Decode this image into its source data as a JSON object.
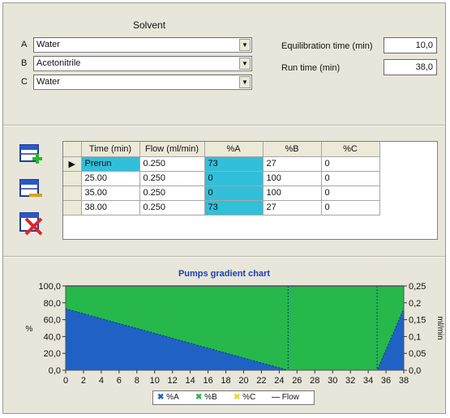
{
  "solvent": {
    "title": "Solvent",
    "rows": [
      {
        "letter": "A",
        "value": "Water"
      },
      {
        "letter": "B",
        "value": "Acetonitrile"
      },
      {
        "letter": "C",
        "value": "Water"
      }
    ]
  },
  "settings": {
    "equilibration_label": "Equilibration time (min)",
    "equilibration_value": "10,0",
    "run_label": "Run time (min)",
    "run_value": "38,0"
  },
  "toolbar": {
    "add_row_icon": "add-row-icon",
    "remove_row_icon": "remove-row-icon",
    "delete_icon": "delete-icon"
  },
  "table": {
    "columns": [
      "Time (min)",
      "Flow (ml/min)",
      "%A",
      "%B",
      "%C"
    ],
    "rows": [
      [
        "Prerun",
        "0.250",
        "73",
        "27",
        "0"
      ],
      [
        "25.00",
        "0.250",
        "0",
        "100",
        "0"
      ],
      [
        "35.00",
        "0.250",
        "0",
        "100",
        "0"
      ],
      [
        "38.00",
        "0.250",
        "73",
        "27",
        "0"
      ]
    ]
  },
  "chart_data": {
    "type": "area",
    "title": "Pumps gradient chart",
    "xlabel": "",
    "ylabel": "%",
    "y2label": "ml/min",
    "x": [
      0,
      25,
      35,
      38
    ],
    "series": [
      {
        "name": "%A",
        "values": [
          73,
          0,
          0,
          73
        ],
        "color": "#1f62c4"
      },
      {
        "name": "%B",
        "values": [
          27,
          100,
          100,
          27
        ],
        "color": "#26b84a"
      },
      {
        "name": "%C",
        "values": [
          0,
          0,
          0,
          0
        ],
        "color": "#e8d820"
      },
      {
        "name": "Flow",
        "values": [
          0.25,
          0.25,
          0.25,
          0.25
        ],
        "color": "#5a2a8c"
      }
    ],
    "xlim": [
      0,
      38
    ],
    "ylim": [
      0,
      100
    ],
    "y2lim": [
      0,
      0.25
    ],
    "xticks": [
      "0",
      "2",
      "4",
      "6",
      "8",
      "10",
      "12",
      "14",
      "16",
      "18",
      "20",
      "22",
      "24",
      "26",
      "28",
      "30",
      "32",
      "34",
      "36",
      "38"
    ],
    "yticks": [
      "0,0",
      "20,0",
      "40,0",
      "60,0",
      "80,0",
      "100,0"
    ],
    "y2ticks": [
      "0,0",
      "0,05",
      "0,1",
      "0,15",
      "0,2",
      "0,25"
    ],
    "legend": [
      "%A",
      "%B",
      "%C",
      "Flow"
    ],
    "legend_position": "bottom"
  }
}
